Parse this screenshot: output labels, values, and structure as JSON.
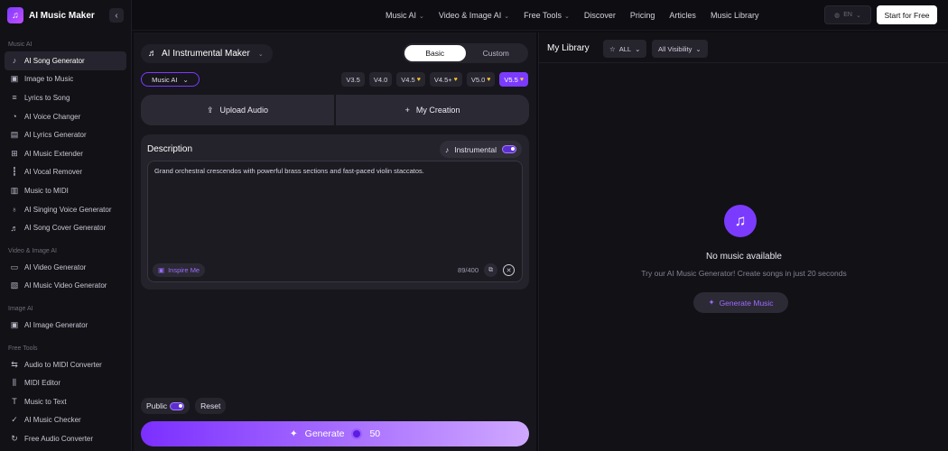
{
  "brand": {
    "name": "AI Music Maker",
    "collapse_icon": "chevron-left-icon"
  },
  "sidebar": {
    "sections": [
      {
        "title": "Music AI",
        "items": [
          {
            "label": "AI Song Generator",
            "icon": "music-note-icon",
            "active": true
          },
          {
            "label": "Image to Music",
            "icon": "image-icon"
          },
          {
            "label": "Lyrics to Song",
            "icon": "lyrics-icon"
          },
          {
            "label": "AI Voice Changer",
            "icon": "voice-icon"
          },
          {
            "label": "AI Lyrics Generator",
            "icon": "document-icon"
          },
          {
            "label": "AI Music Extender",
            "icon": "extend-icon"
          },
          {
            "label": "AI Vocal Remover",
            "icon": "waveform-icon"
          },
          {
            "label": "Music to MIDI",
            "icon": "midi-icon"
          },
          {
            "label": "AI Singing Voice Generator",
            "icon": "microphone-icon"
          },
          {
            "label": "AI Song Cover Generator",
            "icon": "cover-icon"
          }
        ]
      },
      {
        "title": "Video & Image AI",
        "items": [
          {
            "label": "AI Video Generator",
            "icon": "video-icon"
          },
          {
            "label": "AI Music Video Generator",
            "icon": "music-video-icon"
          }
        ]
      },
      {
        "title": "Image AI",
        "items": [
          {
            "label": "AI Image Generator",
            "icon": "image-icon"
          }
        ]
      },
      {
        "title": "Free Tools",
        "items": [
          {
            "label": "Audio to MIDI Converter",
            "icon": "convert-icon"
          },
          {
            "label": "MIDI Editor",
            "icon": "equalizer-icon"
          },
          {
            "label": "Music to Text",
            "icon": "text-icon"
          },
          {
            "label": "AI Music Checker",
            "icon": "check-icon"
          },
          {
            "label": "Free Audio Converter",
            "icon": "refresh-icon"
          }
        ]
      }
    ]
  },
  "topnav": {
    "links": [
      {
        "label": "Music AI",
        "dropdown": true
      },
      {
        "label": "Video & Image AI",
        "dropdown": true
      },
      {
        "label": "Free Tools",
        "dropdown": true
      },
      {
        "label": "Discover",
        "dropdown": false
      },
      {
        "label": "Pricing",
        "dropdown": false
      },
      {
        "label": "Articles",
        "dropdown": false
      },
      {
        "label": "Music Library",
        "dropdown": false
      }
    ],
    "language": "EN",
    "start_label": "Start for Free"
  },
  "maker": {
    "title": "AI Instrumental Maker",
    "modes": [
      "Basic",
      "Custom"
    ],
    "active_mode": "Basic",
    "model_select": "Music AI",
    "versions": [
      {
        "label": "V3.5",
        "premium": false
      },
      {
        "label": "V4.0",
        "premium": false
      },
      {
        "label": "V4.5",
        "premium": true
      },
      {
        "label": "V4.5+",
        "premium": true
      },
      {
        "label": "V5.0",
        "premium": true
      },
      {
        "label": "V5.5",
        "premium": true,
        "selected": true
      }
    ],
    "upload_label": "Upload Audio",
    "creation_label": "My Creation",
    "description_label": "Description",
    "instrumental_label": "Instrumental",
    "instrumental_on": true,
    "description_text": "Grand orchestral crescendos with powerful brass sections and fast-paced violin staccatos.",
    "inspire_label": "Inspire Me",
    "char_count": "89/400",
    "public_label": "Public",
    "reset_label": "Reset",
    "generate_label": "Generate",
    "generate_cost": "50"
  },
  "library": {
    "title": "My Library",
    "filter_all": "ALL",
    "filter_visibility": "All Visibility",
    "empty_title": "No music available",
    "empty_subtitle": "Try our AI Music Generator! Create songs in just 20 seconds",
    "generate_music_label": "Generate Music"
  },
  "colors": {
    "accent": "#7b3bff",
    "background": "#0e0d12",
    "panel": "#17161c",
    "premium_gem": "#ffc928"
  }
}
